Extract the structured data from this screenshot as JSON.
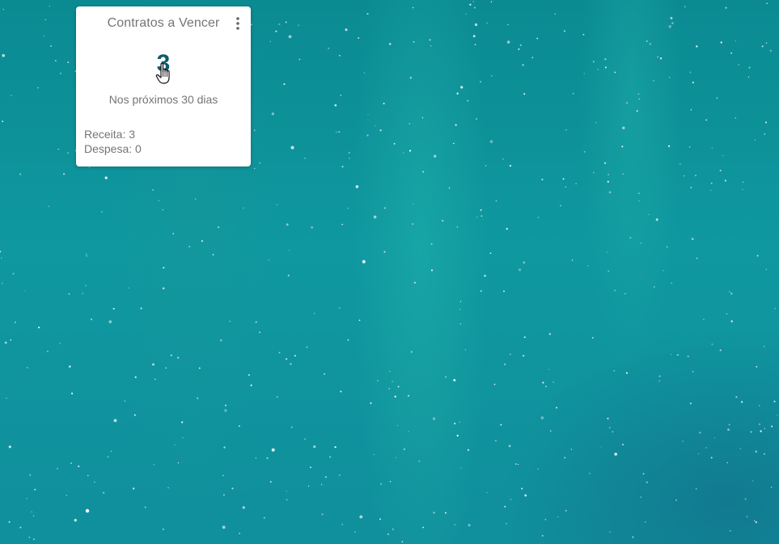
{
  "widget": {
    "title": "Contratos a Vencer",
    "count": "3",
    "subtitle": "Nos próximos 30 dias",
    "receita": "Receita: 3",
    "despesa": "Despesa: 0",
    "menu_icon": "more-vert-icon",
    "accent_color": "#0f5b6b"
  },
  "background": {
    "description_color": "#0f98a0"
  }
}
